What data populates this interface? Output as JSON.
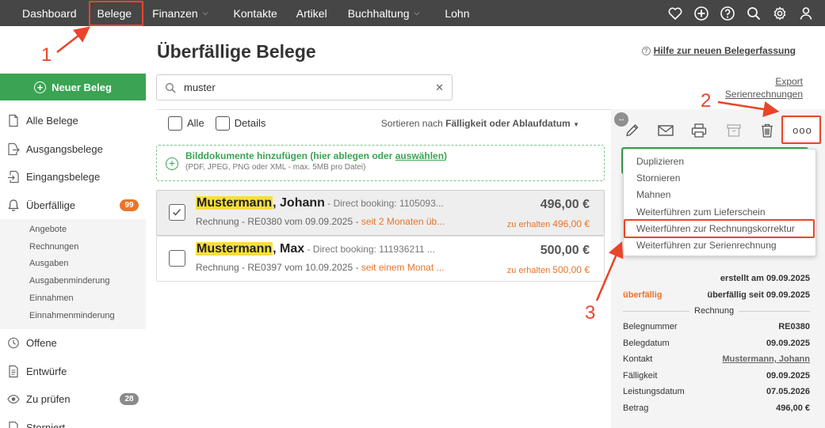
{
  "nav": {
    "items": [
      {
        "label": "Dashboard",
        "dropdown": false
      },
      {
        "label": "Belege",
        "dropdown": false
      },
      {
        "label": "Finanzen",
        "dropdown": true
      },
      {
        "label": "Kontakte",
        "dropdown": false
      },
      {
        "label": "Artikel",
        "dropdown": false
      },
      {
        "label": "Buchhaltung",
        "dropdown": true
      },
      {
        "label": "Lohn",
        "dropdown": false
      }
    ],
    "icons": [
      "heart-icon",
      "plus-circle-icon",
      "help-icon",
      "search-icon",
      "gear-icon",
      "user-icon"
    ]
  },
  "sidebar": {
    "new_button": "Neuer Beleg",
    "items": [
      {
        "label": "Alle Belege",
        "icon": "document-icon"
      },
      {
        "label": "Ausgangsbelege",
        "icon": "outgoing-document-icon"
      },
      {
        "label": "Eingangsbelege",
        "icon": "incoming-document-icon"
      }
    ],
    "overdue": {
      "label": "Überfällige",
      "badge": "99",
      "icon": "bell-icon"
    },
    "sub_items": [
      "Angebote",
      "Rechnungen",
      "Ausgaben",
      "Ausgabenminderung",
      "Einnahmen",
      "Einnahmenminderung"
    ],
    "offene": "Offene",
    "entwuerfe": "Entwürfe",
    "zu_pruefen": {
      "label": "Zu prüfen",
      "badge": "28"
    },
    "storniert": "Storniert"
  },
  "main": {
    "title": "Überfällige Belege",
    "help_link": "Hilfe zur neuen Belegerfassung",
    "search_value": "muster",
    "export": "Export",
    "serienrechnungen": "Serienrechnungen",
    "check_all": "Alle",
    "check_details": "Details",
    "sort_prefix": "Sortieren nach",
    "sort_value": "Fälligkeit oder Ablaufdatum",
    "drop_main_prefix": "Bilddokumente hinzufügen (hier ablegen oder ",
    "drop_main_link": "auswählen",
    "drop_main_suffix": ")",
    "drop_sub": "(PDF, JPEG, PNG oder XML - max. 5MB pro Datei)",
    "documents": [
      {
        "name_highlight": "Mustermann",
        "name_rest": ", Johann",
        "meta": " - Direct booking: 1105093...",
        "line2_prefix": "Rechnung - RE0380 vom 09.09.2025 - ",
        "line2_overdue": "seit 2 Monaten üb...",
        "amount": "496,00 €",
        "due_label": "zu erhalten ",
        "due_amount": "496,00 €",
        "selected": true
      },
      {
        "name_highlight": "Mustermann",
        "name_rest": ", Max",
        "meta": " - Direct booking: 111936211 ...",
        "line2_prefix": "Rechnung - RE0397 vom 10.09.2025 - ",
        "line2_overdue": "seit einem Monat ...",
        "amount": "500,00 €",
        "due_label": "zu erhalten ",
        "due_amount": "500,00 €",
        "selected": false
      }
    ]
  },
  "panel": {
    "more_button": "ooo",
    "menu": [
      "Duplizieren",
      "Stornieren",
      "Mahnen",
      "Weiterführen zum Lieferschein",
      "Weiterführen zur Rechnungskorrektur",
      "Weiterführen zur Serienrechnung"
    ],
    "created": "erstellt am 09.09.2025",
    "status": "überfällig",
    "status_since": "überfällig seit 09.09.2025",
    "section": "Rechnung",
    "fields": [
      {
        "label": "Belegnummer",
        "value": "RE0380"
      },
      {
        "label": "Belegdatum",
        "value": "09.09.2025"
      },
      {
        "label": "Kontakt",
        "value": "Mustermann, Johann"
      },
      {
        "label": "Fälligkeit",
        "value": "09.09.2025"
      },
      {
        "label": "Leistungsdatum",
        "value": "07.05.2026"
      },
      {
        "label": "Betrag",
        "value": "496,00 €"
      }
    ]
  },
  "annotations": [
    "1",
    "2",
    "3"
  ],
  "colors": {
    "accent_red": "#e8452a",
    "green": "#3aa452",
    "orange": "#e9742a",
    "highlight": "#f9de3c",
    "nav_bg": "#464646"
  }
}
